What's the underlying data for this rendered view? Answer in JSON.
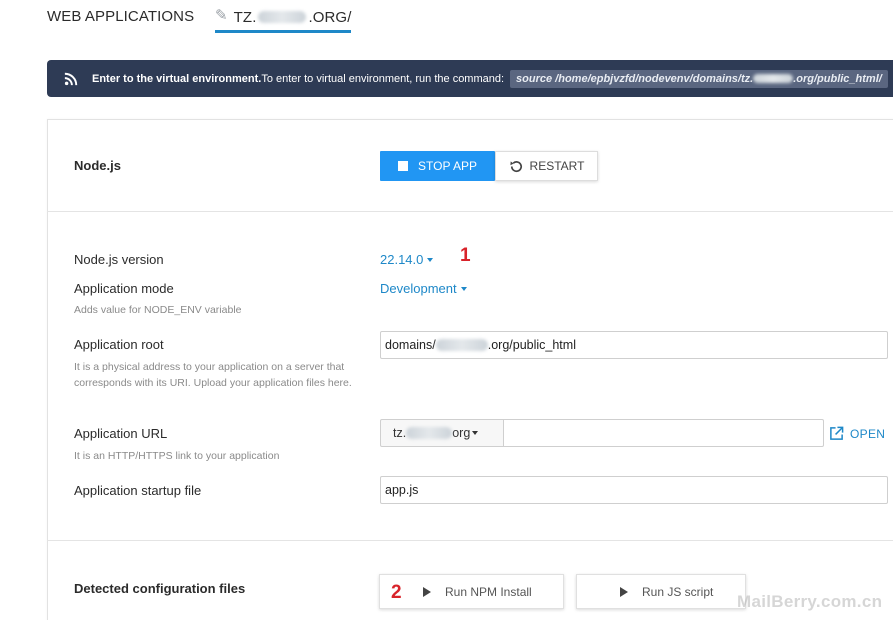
{
  "tabs": {
    "web_applications": "WEB APPLICATIONS",
    "domain_prefix": "TZ.",
    "domain_suffix": ".ORG/"
  },
  "banner": {
    "title": "Enter to the virtual environment.",
    "text": "To enter to virtual environment, run the command:",
    "command": "source /home/epbjvzfd/nodevenv/domains/tz.",
    "command_suffix": ".org/public_html/"
  },
  "header": {
    "label": "Node.js",
    "stop_label": "STOP APP",
    "restart_label": "RESTART"
  },
  "form": {
    "version_label": "Node.js version",
    "version_value": "22.14.0",
    "mode_label": "Application mode",
    "mode_hint": "Adds value for NODE_ENV variable",
    "mode_value": "Development",
    "root_label": "Application root",
    "root_hint": "It is a physical address to your application on a server that corresponds with its URI. Upload your application files here.",
    "root_prefix": "domains/",
    "root_suffix": ".org/public_html",
    "url_label": "Application URL",
    "url_hint": "It is an HTTP/HTTPS link to your application",
    "url_prefix": "tz.",
    "url_suffix": "org",
    "url_value": "",
    "open_label": "OPEN",
    "startup_label": "Application startup file",
    "startup_value": "app.js"
  },
  "config": {
    "label": "Detected configuration files",
    "npm_label": "Run NPM Install",
    "js_label": "Run JS script"
  },
  "annotations": {
    "step1": "1",
    "step2": "2"
  },
  "watermark": "MailBerry.com.cn",
  "colors": {
    "accent": "#2196f3",
    "link": "#1e88c8",
    "banner_bg": "#2e3b55",
    "annotation": "#d8232a"
  }
}
